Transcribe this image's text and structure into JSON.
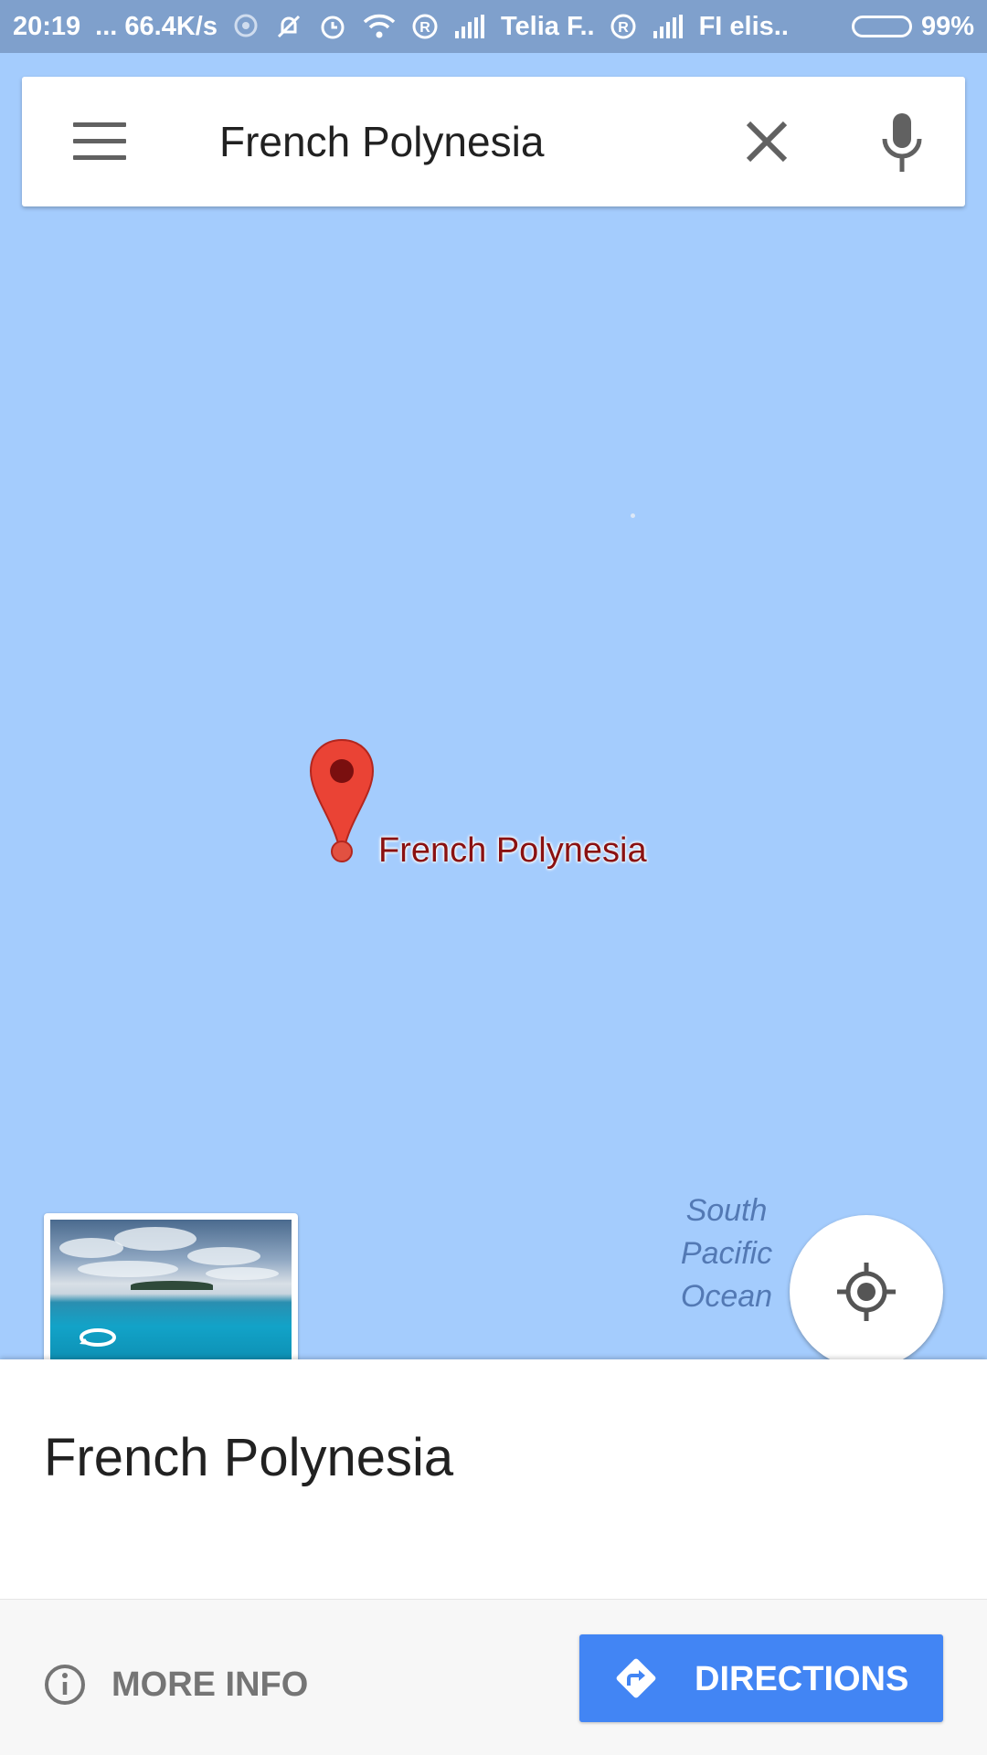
{
  "status_bar": {
    "time": "20:19",
    "network_speed": "... 66.4K/s",
    "carrier_1": "Telia F..",
    "carrier_2": "FI elis..",
    "battery": "99%",
    "battery_level": 0.99
  },
  "search": {
    "query": "French Polynesia",
    "menu_icon": "hamburger-menu-icon",
    "clear_icon": "close-icon",
    "voice_icon": "microphone-icon"
  },
  "map": {
    "pin_label": "French Polynesia",
    "ocean_label": "South Pacific Ocean",
    "background_color": "#a4ccfd",
    "pin_color": "#e74c3c"
  },
  "place": {
    "title": "French Polynesia"
  },
  "actions": {
    "more_info_label": "MORE INFO",
    "directions_label": "DIRECTIONS",
    "directions_color": "#4285f4"
  }
}
